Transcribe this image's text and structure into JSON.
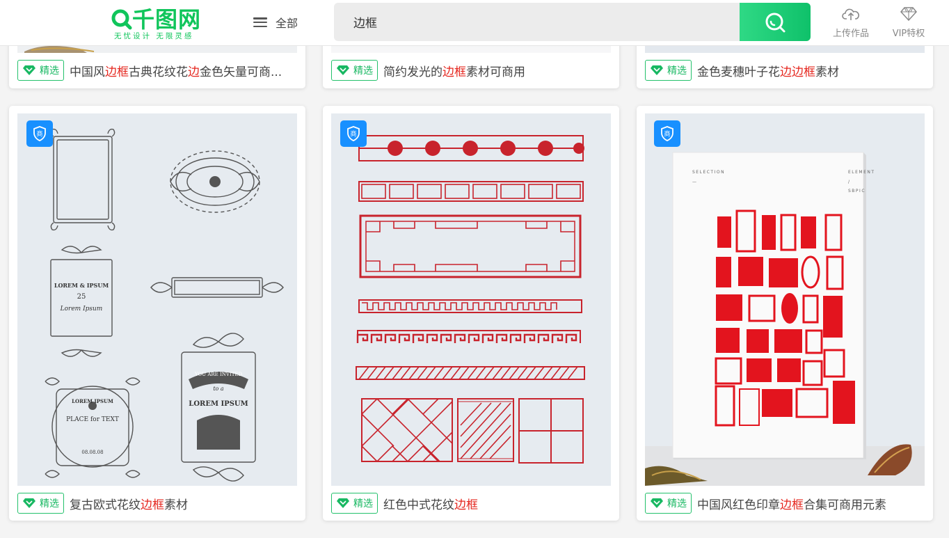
{
  "header": {
    "logo_text": "千图网",
    "logo_tagline": "无忧设计 无限灵感",
    "menu_label": "全部",
    "search_value": "边框",
    "upload_label": "上传作品",
    "vip_label": "VIP特权"
  },
  "badge_label": "精选",
  "commercial_label": "商",
  "cards_top": [
    {
      "title_pre": "中国风",
      "title_hl": "边框",
      "title_mid": "古典花纹花",
      "title_hl2": "边",
      "title_post": "金色矢量可商..."
    },
    {
      "title_pre": "简约发光的",
      "title_hl": "边框",
      "title_mid": "素材可商用",
      "title_hl2": "",
      "title_post": ""
    },
    {
      "title_pre": "金色麦穗叶子花",
      "title_hl": "边边框",
      "title_mid": "素材",
      "title_hl2": "",
      "title_post": ""
    }
  ],
  "cards_bottom": [
    {
      "title_pre": "复古欧式花纹",
      "title_hl": "边框",
      "title_post": "素材"
    },
    {
      "title_pre": "红色中式花纹",
      "title_hl": "边框",
      "title_post": ""
    },
    {
      "title_pre": "中国风红色印章",
      "title_hl": "边框",
      "title_post": "合集可商用元素"
    }
  ],
  "thumb_text": {
    "lorem_ipsum": "LOREM & IPSUM",
    "date_number": "25",
    "script_text": "Lorem Ipsum",
    "lorem_ipsum_2": "LOREM IPSUM",
    "place_text": "PLACE for TEXT",
    "date_text": "08.08.08",
    "invited": "YOU ARE INVITED",
    "to_a": "to a",
    "lorem_ipsum_3": "LOREM IPSUM",
    "selection": "SELECTION",
    "element": "ELEMENT",
    "sbpic": "SBPIC"
  },
  "colors": {
    "brand_green": "#10c55b",
    "highlight_red": "#e5261e",
    "commercial_blue": "#1890ff"
  }
}
